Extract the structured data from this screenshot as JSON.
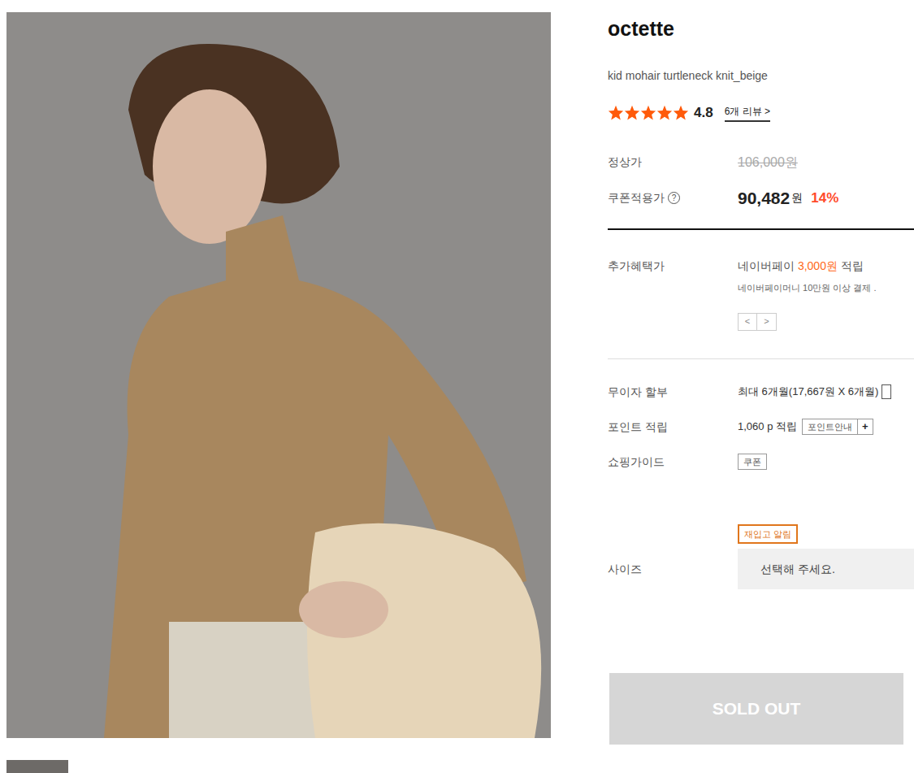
{
  "brand": "octette",
  "product_name": "kid mohair turtleneck knit_beige",
  "rating": {
    "stars": 5,
    "score": "4.8",
    "reviews_link": "6개 리뷰 >"
  },
  "price": {
    "regular_label": "정상가",
    "regular": "106,000원",
    "coupon_label": "쿠폰적용가",
    "help_icon": "?",
    "coupon_price": "90,482",
    "currency": "원",
    "discount": "14%"
  },
  "benefit": {
    "label": "추가혜택가",
    "line1_prefix": "네이버페이 ",
    "line1_amount": "3,000원",
    "line1_suffix": " 적립",
    "line2": "네이버페이머니 10만원 이상 결제 .",
    "prev": "<",
    "next": ">"
  },
  "info_rows": [
    {
      "kind": "text",
      "label": "무이자 할부",
      "value": "최대 6개월(17,667원 X 6개월)"
    },
    {
      "kind": "points",
      "label": "포인트 적립",
      "value": "1,060 p 적립",
      "button": "포인트안내",
      "plus": "+"
    },
    {
      "kind": "button",
      "label": "쇼핑가이드",
      "button": "쿠폰"
    }
  ],
  "restock_badge": "재입고 알림",
  "size": {
    "label": "사이즈",
    "placeholder": "선택해 주세요."
  },
  "sold_out_button": "SOLD OUT"
}
